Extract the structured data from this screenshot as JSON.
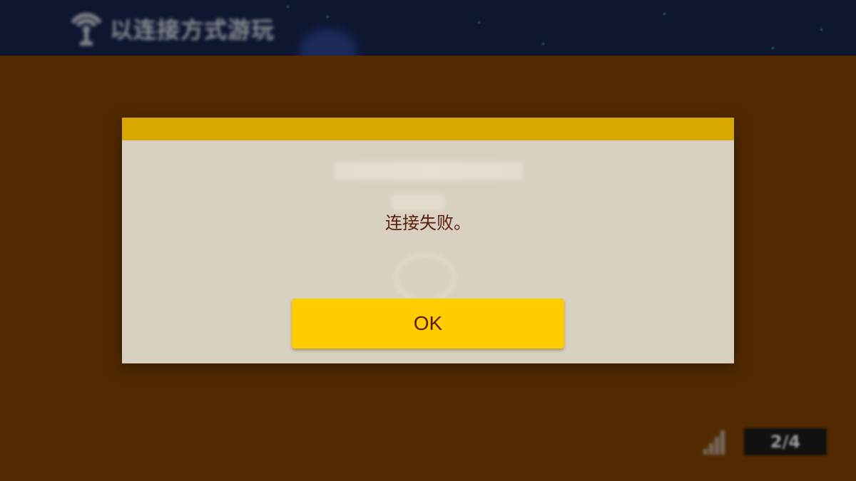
{
  "background": {
    "header_title": "以连接方式游玩",
    "page_counter": "2/4"
  },
  "dialog": {
    "message": "连接失败。",
    "ok_label": "OK"
  },
  "colors": {
    "page_background": "#522900",
    "header_background": "#0e1630",
    "dialog_background": "#d8d1c1",
    "dialog_topbar": "#d6a800",
    "button_background": "#ffcc00",
    "text": "#5a1c0c"
  },
  "icons": {
    "header_icon": "wireless-antenna-icon",
    "signal_icon": "signal-strength-icon"
  }
}
